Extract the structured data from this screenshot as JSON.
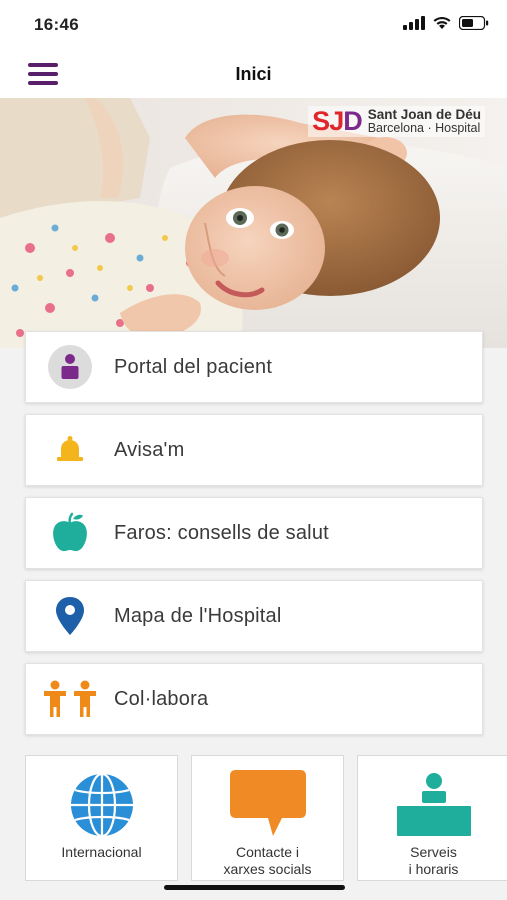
{
  "status_bar": {
    "time": "16:46"
  },
  "header": {
    "title": "Inici",
    "menu_icon": "hamburger-menu-icon"
  },
  "hero": {
    "brand_mark": "SJD",
    "brand_name": "Sant Joan de Déu",
    "brand_sub": "Barcelona · Hospital"
  },
  "menu": {
    "items": [
      {
        "label": "Portal del pacient",
        "icon": "patient-portal-icon",
        "color": "#7b2a8c"
      },
      {
        "label": "Avisa'm",
        "icon": "bell-icon",
        "color": "#f4b51c"
      },
      {
        "label": "Faros: consells de salut",
        "icon": "apple-icon",
        "color": "#1fae9b"
      },
      {
        "label": "Mapa de l'Hospital",
        "icon": "map-pin-icon",
        "color": "#1d5fa8"
      },
      {
        "label": "Col·labora",
        "icon": "children-icon",
        "color": "#ef8a18"
      }
    ]
  },
  "tiles": [
    {
      "label": "Internacional",
      "icon": "globe-icon",
      "color": "#2a8fd6"
    },
    {
      "label": "Contacte i\nxarxes socials",
      "icon": "speech-bubble-icon",
      "color": "#f08a24"
    },
    {
      "label": "Serveis\ni horaris",
      "icon": "reception-desk-icon",
      "color": "#1fae9b"
    }
  ]
}
